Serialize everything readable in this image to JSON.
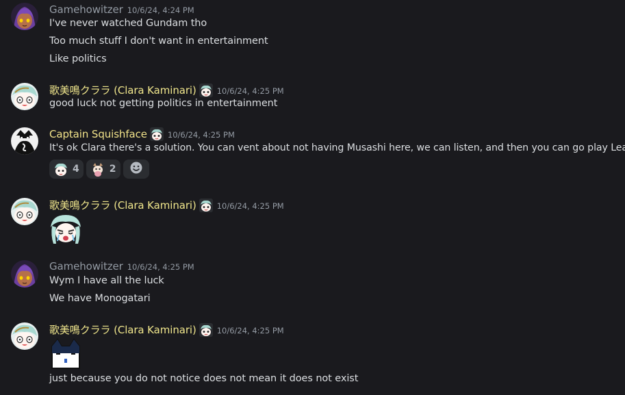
{
  "colors": {
    "gamehowitzer": "#949ba4",
    "clara": "#f0e68c",
    "squishface": "#f2e38a",
    "timestamp": "#949ba4",
    "background": "#1a1a1e"
  },
  "messages": [
    {
      "author": "Gamehowitzer",
      "timestamp": "10/6/24, 4:24 PM",
      "lines": [
        "I've never watched Gundam tho",
        "Too much stuff I don't want in entertainment",
        "Like politics"
      ]
    },
    {
      "author": "歌美鳴クララ (Clara Kaminari)",
      "timestamp": "10/6/24, 4:25 PM",
      "lines": [
        "good luck not getting politics in entertainment"
      ]
    },
    {
      "author": "Captain Squishface",
      "timestamp": "10/6/24, 4:25 PM",
      "lines": [
        "It's ok Clara there's a solution.  You can vent about not having Musashi here, we can listen, and then you can go play League"
      ],
      "reactions": [
        {
          "emoji": "clara-emoji",
          "count": "4"
        },
        {
          "emoji": "dog-emoji",
          "count": "2"
        }
      ]
    },
    {
      "author": "歌美鳴クララ (Clara Kaminari)",
      "timestamp": "10/6/24, 4:25 PM",
      "sticker": "clara-crying-sticker"
    },
    {
      "author": "Gamehowitzer",
      "timestamp": "10/6/24, 4:25 PM",
      "lines": [
        "Wym I have all the luck",
        "We have Monogatari"
      ]
    },
    {
      "author": "歌美鳴クララ (Clara Kaminari)",
      "timestamp": "10/6/24, 4:25 PM",
      "sticker": "cat-sticker",
      "lines": [
        "just because you do not notice does not mean it does not exist"
      ]
    }
  ]
}
